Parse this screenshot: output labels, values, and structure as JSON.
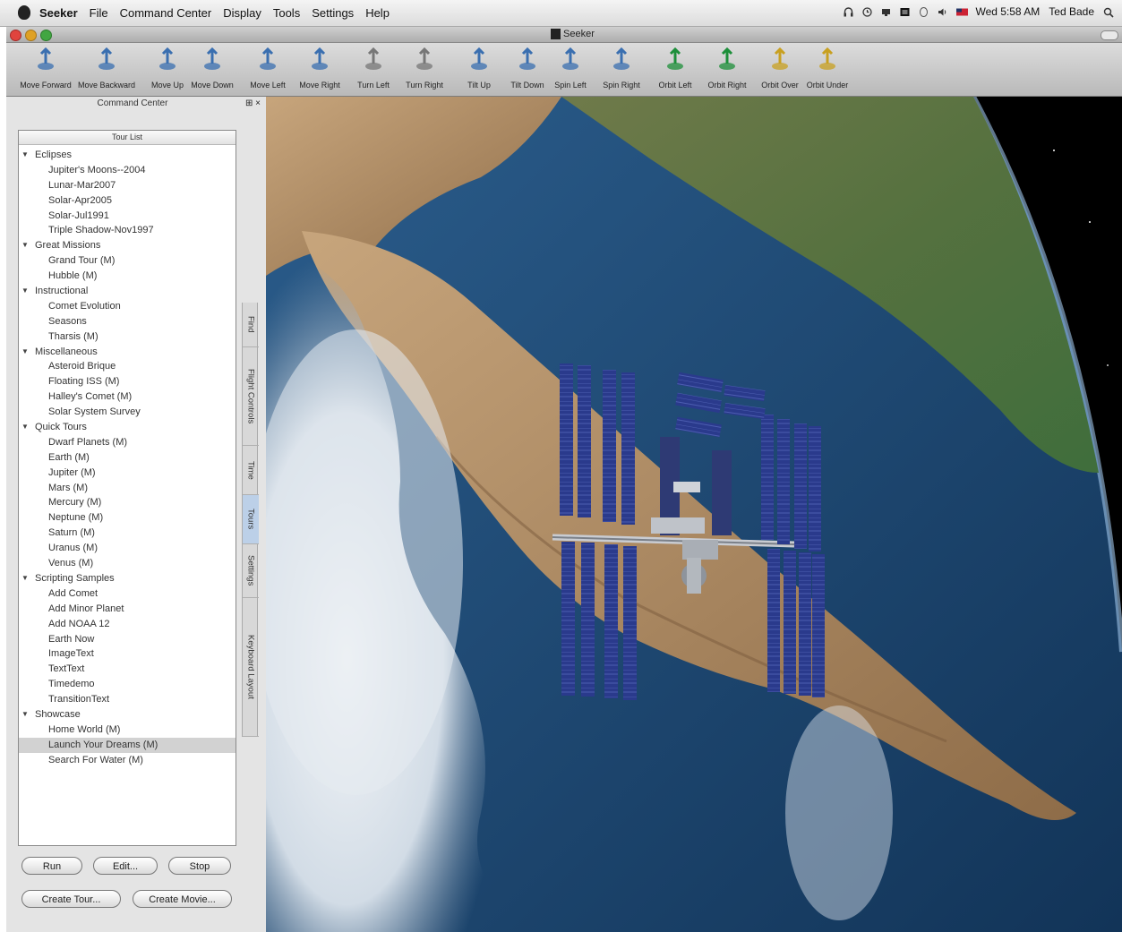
{
  "menubar": {
    "app_name": "Seeker",
    "menus": [
      "File",
      "Command Center",
      "Display",
      "Tools",
      "Settings",
      "Help"
    ],
    "clock": "Wed 5:58 AM",
    "user": "Ted Bade",
    "status_icons": [
      "headphones-icon",
      "time-machine-icon",
      "screen-icon",
      "display-icon",
      "bluetooth-icon",
      "wifi-icon",
      "volume-icon",
      "flag-icon"
    ]
  },
  "window": {
    "title": "Seeker"
  },
  "toolbar": {
    "buttons": [
      {
        "label": "Move Forward",
        "icon": "move-forward-icon"
      },
      {
        "label": "Move Backward",
        "icon": "move-backward-icon"
      },
      {
        "label": "Move Up",
        "icon": "move-up-icon"
      },
      {
        "label": "Move Down",
        "icon": "move-down-icon"
      },
      {
        "label": "Move Left",
        "icon": "move-left-icon"
      },
      {
        "label": "Move Right",
        "icon": "move-right-icon"
      },
      {
        "label": "Turn Left",
        "icon": "turn-left-icon"
      },
      {
        "label": "Turn Right",
        "icon": "turn-right-icon"
      },
      {
        "label": "Tilt Up",
        "icon": "tilt-up-icon"
      },
      {
        "label": "Tilt Down",
        "icon": "tilt-down-icon"
      },
      {
        "label": "Spin Left",
        "icon": "spin-left-icon"
      },
      {
        "label": "Spin Right",
        "icon": "spin-right-icon"
      },
      {
        "label": "Orbit Left",
        "icon": "orbit-left-icon"
      },
      {
        "label": "Orbit Right",
        "icon": "orbit-right-icon"
      },
      {
        "label": "Orbit Over",
        "icon": "orbit-over-icon"
      },
      {
        "label": "Orbit Under",
        "icon": "orbit-under-icon"
      }
    ]
  },
  "command_center": {
    "title": "Command Center",
    "tour_list_header": "Tour List",
    "tree": [
      {
        "label": "Eclipses",
        "items": [
          "Jupiter's Moons--2004",
          "Lunar-Mar2007",
          "Solar-Apr2005",
          "Solar-Jul1991",
          "Triple Shadow-Nov1997"
        ]
      },
      {
        "label": "Great Missions",
        "items": [
          "Grand Tour (M)",
          "Hubble (M)"
        ]
      },
      {
        "label": "Instructional",
        "items": [
          "Comet Evolution",
          "Seasons",
          "Tharsis (M)"
        ]
      },
      {
        "label": "Miscellaneous",
        "items": [
          "Asteroid Brique",
          "Floating ISS (M)",
          "Halley's Comet (M)",
          "Solar System Survey"
        ]
      },
      {
        "label": "Quick Tours",
        "items": [
          "Dwarf Planets (M)",
          "Earth (M)",
          "Jupiter (M)",
          "Mars (M)",
          "Mercury (M)",
          "Neptune (M)",
          "Saturn (M)",
          "Uranus (M)",
          "Venus (M)"
        ]
      },
      {
        "label": "Scripting Samples",
        "items": [
          "Add Comet",
          "Add Minor Planet",
          "Add NOAA 12",
          "Earth Now",
          "ImageText",
          "TextText",
          "Timedemo",
          "TransitionText"
        ]
      },
      {
        "label": "Showcase",
        "items": [
          "Home World (M)",
          "Launch Your Dreams (M)",
          "Search For Water (M)"
        ]
      }
    ],
    "selected_item": "Launch Your Dreams (M)",
    "buttons": {
      "run": "Run",
      "edit": "Edit...",
      "stop": "Stop",
      "create_tour": "Create Tour...",
      "create_movie": "Create Movie..."
    },
    "side_tabs": [
      "Find",
      "Flight Controls",
      "Time",
      "Tours",
      "Settings",
      "Keyboard Layout"
    ],
    "active_side_tab": "Tours"
  },
  "colors": {
    "selection": "#d2d2d2",
    "space": "#000000",
    "ocean": "#1d4a78",
    "land": "#b89a72",
    "solar_panel": "#2a3a8c"
  }
}
